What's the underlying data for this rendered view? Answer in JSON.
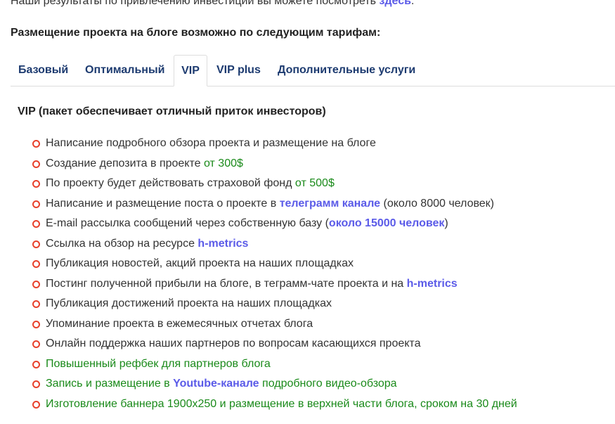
{
  "intro": {
    "text": "Наши результаты по привлечению инвестиции вы можете посмотреть ",
    "link": "здесь",
    "tail": "."
  },
  "heading": "Размещение проекта на блоге возможно по следующим тарифам:",
  "tabs": [
    {
      "label": "Базовый"
    },
    {
      "label": "Оптимальный"
    },
    {
      "label": "VIP"
    },
    {
      "label": "VIP plus"
    },
    {
      "label": "Дополнительные услуги"
    }
  ],
  "active_tab": "VIP",
  "panel": {
    "title": "VIP (пакет обеспечивает отличный приток инвесторов)",
    "items": [
      {
        "t1": "Написание подробного обзора проекта и размещение на блоге"
      },
      {
        "t1": "Создание депозита в проекте ",
        "t2": "от 300$"
      },
      {
        "t1": "По проекту будет действовать страховой фонд ",
        "t2": "от 500$"
      },
      {
        "t1": "Написание и размещение поста о проекте в ",
        "t2": "телеграмм канале",
        "t3": " (около 8000 человек)"
      },
      {
        "t1": "E-mail рассылка сообщений через собственную базу (",
        "t2": "около 15000 человек",
        "t3": ")"
      },
      {
        "t1": "Ссылка на обзор на ресурсе ",
        "t2": "h-metrics"
      },
      {
        "t1": "Публикация новостей, акций проекта на наших площадках"
      },
      {
        "t1": "Постинг полученной прибыли на блоге, в теграмм-чате проекта и на ",
        "t2": "h-metrics"
      },
      {
        "t1": "Публикация достижений проекта на наших площадках"
      },
      {
        "t1": "Упоминание проекта в ежемесячных отчетах блога"
      },
      {
        "t1": "Онлайн поддержка наших партнеров по вопросам касающихся проекта"
      },
      {
        "t1": "Повышенный рефбек для партнеров блога"
      },
      {
        "t1": "Запись и размещение в ",
        "t2": "Youtube-канале",
        "t3": " подробного видео-обзора"
      },
      {
        "t1": "Изготовление баннера 1900x250 и размещение в верхней части блога, сроком на 30 дней"
      }
    ]
  },
  "colors": {
    "bullet": "#e8412c",
    "link": "#5b5be8",
    "green_text": "#1a8a1a",
    "tab_text": "#1d3b70"
  }
}
